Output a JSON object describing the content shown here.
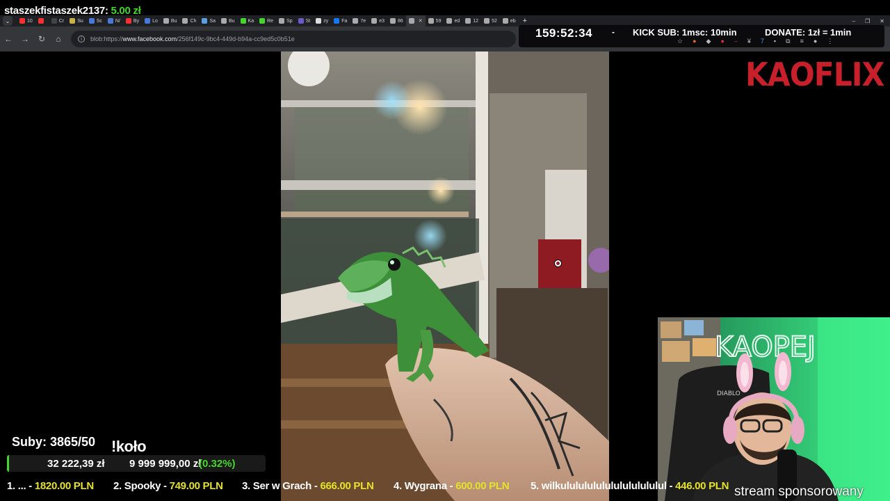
{
  "donor_alert": {
    "name": "staszekfistaszek2137:",
    "amount": "5.00 zł"
  },
  "tabs": [
    {
      "label": "10",
      "color": "#ff3030"
    },
    {
      "label": "",
      "color": "#ff3030"
    },
    {
      "label": "Cr",
      "color": "#444"
    },
    {
      "label": "Su",
      "color": "#c9b04a"
    },
    {
      "label": "Sc",
      "color": "#4a78d6"
    },
    {
      "label": "N/",
      "color": "#4a78d6"
    },
    {
      "label": "By",
      "color": "#ff3030"
    },
    {
      "label": "Lo",
      "color": "#4a78d6"
    },
    {
      "label": "Bu",
      "color": "#aaa"
    },
    {
      "label": "Ch",
      "color": "#aaa"
    },
    {
      "label": "Sa",
      "color": "#5aa0e0"
    },
    {
      "label": "Bu",
      "color": "#aaa"
    },
    {
      "label": "Ka",
      "color": "#44d62c"
    },
    {
      "label": "Re",
      "color": "#44d62c"
    },
    {
      "label": "Sp",
      "color": "#aaa"
    },
    {
      "label": "St",
      "color": "#6a5acd"
    },
    {
      "label": "zy",
      "color": "#ddd"
    },
    {
      "label": "Fa",
      "color": "#1877f2"
    },
    {
      "label": "7e",
      "color": "#aaa"
    },
    {
      "label": "e3",
      "color": "#aaa"
    },
    {
      "label": "86",
      "color": "#aaa"
    },
    {
      "label": "",
      "color": "#aaa",
      "active": true
    },
    {
      "label": "59",
      "color": "#aaa"
    },
    {
      "label": "ed",
      "color": "#aaa"
    },
    {
      "label": "12",
      "color": "#aaa"
    },
    {
      "label": "52",
      "color": "#aaa"
    },
    {
      "label": "eb",
      "color": "#aaa"
    }
  ],
  "address": {
    "prefix": "blob:https://",
    "host": "www.facebook.com",
    "path": "/256f149c-9bc4-449d-b94a-cc9ed5c0b51e"
  },
  "overlay": {
    "timer": "159:52:34",
    "dash": "-",
    "kick_sub": "KICK SUB: 1msc: 10min",
    "donate": "DONATE: 1zł = 1min",
    "brand": "KAOFLIX"
  },
  "subs": {
    "label": "Suby: 3865/50",
    "wheel": "!koło"
  },
  "goal": {
    "current": "32 222,39 zł",
    "target": "9 999 999,00 zł",
    "percent_label": "(0.32%)",
    "fraction": 0.0032
  },
  "leaderboard": [
    {
      "rank": "1. ... - ",
      "value": "1820.00 PLN"
    },
    {
      "rank": "2. Spooky - ",
      "value": "749.00 PLN"
    },
    {
      "rank": "3. Ser w Grach - ",
      "value": "666.00 PLN"
    },
    {
      "rank": "4. Wygrana - ",
      "value": "600.00 PLN"
    },
    {
      "rank": "5. wilkulululululululululululul - ",
      "value": "446.00 PLN"
    }
  ],
  "sponsor": "stream sponsorowany",
  "webcam_sign": "KAOPEJ",
  "chair_brand": "DIABLO"
}
